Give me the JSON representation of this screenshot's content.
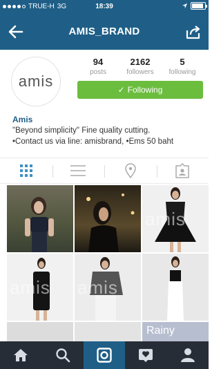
{
  "status_bar": {
    "carrier": "TRUE-H",
    "network": "3G",
    "time": "18:39",
    "battery_level": 0.9
  },
  "nav": {
    "title": "AMIS_BRAND",
    "back_icon": "arrow-left-icon",
    "share_icon": "share-icon"
  },
  "profile": {
    "avatar_text": "amis",
    "stats": [
      {
        "value": "94",
        "label": "posts"
      },
      {
        "value": "2162",
        "label": "followers"
      },
      {
        "value": "5",
        "label": "following"
      }
    ],
    "follow_button": {
      "check": "✓",
      "label": "Following"
    }
  },
  "bio": {
    "name": "Amis",
    "line1": "\"Beyond simplicity\" Fine quality cutting.",
    "line2": "•Contact us via line: amisbrand, •Ems 50 baht"
  },
  "tabs": [
    "grid-icon",
    "list-icon",
    "location-icon",
    "tagged-icon"
  ],
  "photos": {
    "watermark": "amis",
    "rainy_text": "Rainy"
  },
  "bottom_bar": [
    "home-icon",
    "search-icon",
    "camera-icon",
    "activity-icon",
    "profile-icon"
  ],
  "colors": {
    "brand_blue": "#1f5f87",
    "follow_green": "#6bbd3e",
    "tab_bar": "#262d36"
  }
}
